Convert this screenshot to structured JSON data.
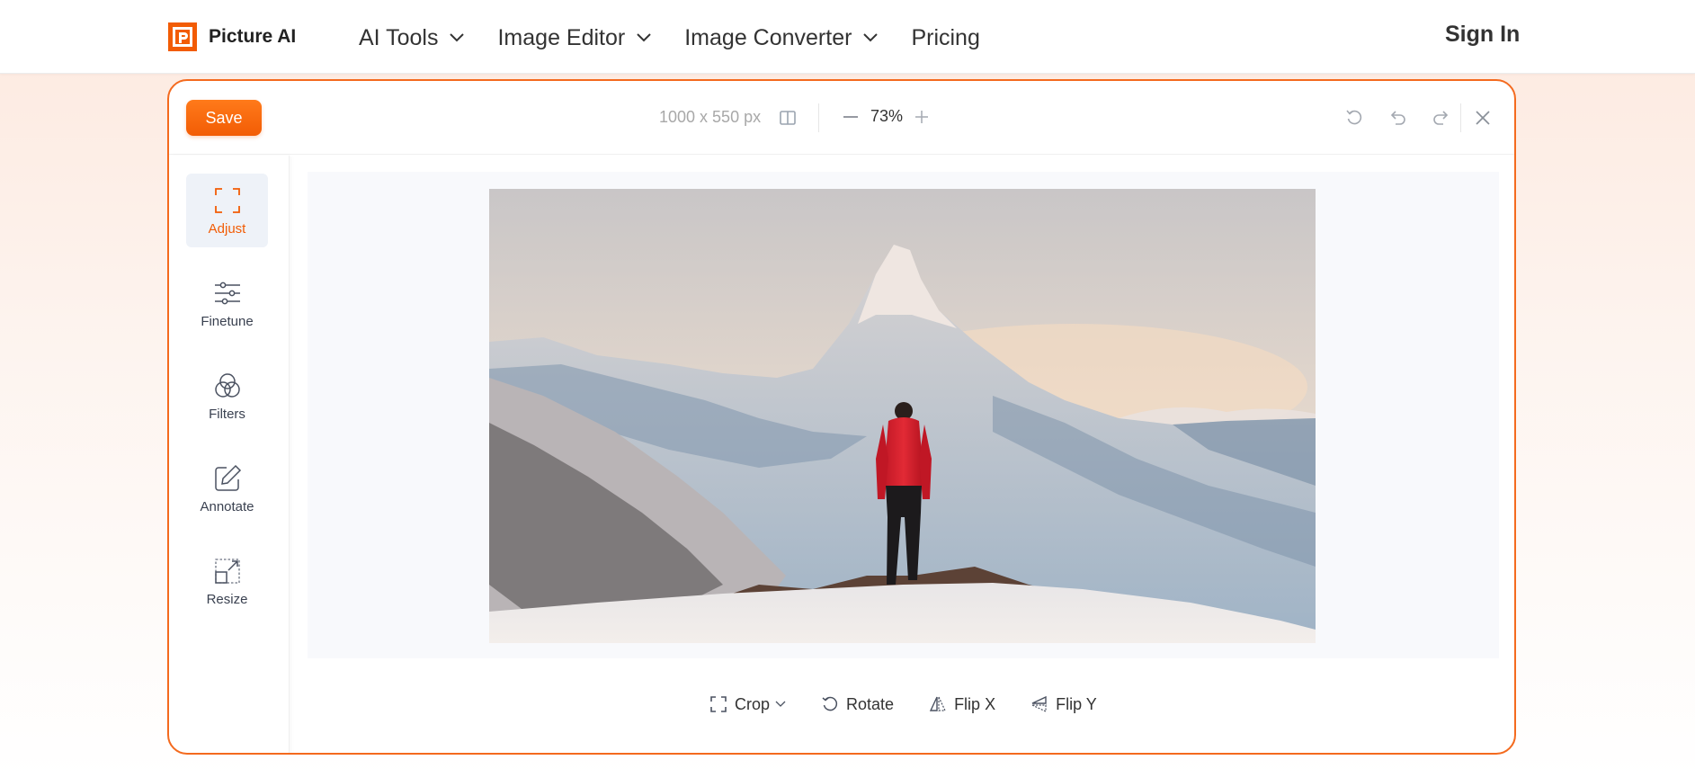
{
  "brand": {
    "name": "Picture AI",
    "logo_letter": "P",
    "accent": "#f25c05"
  },
  "nav": {
    "items": [
      {
        "label": "AI Tools",
        "has_dropdown": true
      },
      {
        "label": "Image Editor",
        "has_dropdown": true
      },
      {
        "label": "Image Converter",
        "has_dropdown": true
      },
      {
        "label": "Pricing",
        "has_dropdown": false
      }
    ],
    "signin_label": "Sign In"
  },
  "editor": {
    "save_label": "Save",
    "dimensions": "1000 x 550 px",
    "zoom": "73%",
    "toolbar_icons": [
      "compare-icon",
      "zoom-out-icon",
      "zoom-in-icon",
      "reset-icon",
      "undo-icon",
      "redo-icon",
      "close-icon"
    ],
    "sidebar": [
      {
        "label": "Adjust",
        "icon": "crop-frame-icon",
        "active": true
      },
      {
        "label": "Finetune",
        "icon": "sliders-icon",
        "active": false
      },
      {
        "label": "Filters",
        "icon": "filters-icon",
        "active": false
      },
      {
        "label": "Annotate",
        "icon": "pencil-square-icon",
        "active": false
      },
      {
        "label": "Resize",
        "icon": "resize-icon",
        "active": false
      }
    ],
    "bottom_tools": [
      {
        "label": "Crop",
        "icon": "crop-icon",
        "has_dropdown": true
      },
      {
        "label": "Rotate",
        "icon": "rotate-icon",
        "has_dropdown": false
      },
      {
        "label": "Flip X",
        "icon": "flip-x-icon",
        "has_dropdown": false
      },
      {
        "label": "Flip Y",
        "icon": "flip-y-icon",
        "has_dropdown": false
      }
    ]
  }
}
